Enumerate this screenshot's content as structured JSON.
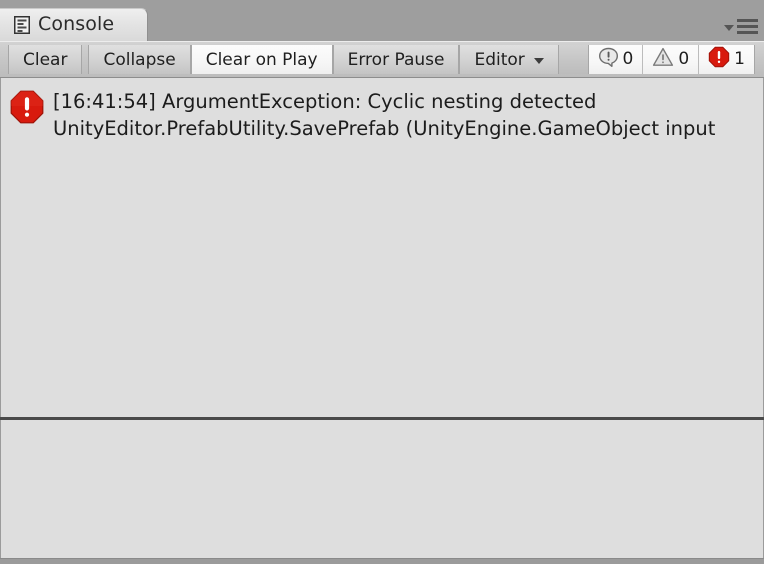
{
  "window": {
    "tab": {
      "label": "Console",
      "icon": "console-document-icon"
    },
    "menu": {
      "icon": "hamburger-menu-icon",
      "caret_icon": "caret-down-icon"
    }
  },
  "toolbar": {
    "buttons": [
      {
        "label": "Clear",
        "name": "clear-button",
        "active": false
      },
      {
        "label": "Collapse",
        "name": "collapse-button",
        "active": false
      },
      {
        "label": "Clear on Play",
        "name": "clear-on-play-button",
        "active": true
      },
      {
        "label": "Error Pause",
        "name": "error-pause-button",
        "active": false
      },
      {
        "label": "Editor",
        "name": "editor-dropdown-button",
        "active": false
      }
    ],
    "counts": [
      {
        "type": "log",
        "icon": "log-bubble-icon",
        "value": "0"
      },
      {
        "type": "warning",
        "icon": "warning-triangle-icon",
        "value": "0"
      },
      {
        "type": "error",
        "icon": "error-octagon-icon",
        "value": "1"
      }
    ]
  },
  "console": {
    "messages": [
      {
        "severity": "error",
        "icon": "error-octagon-icon",
        "line1": "[16:41:54] ArgumentException: Cyclic nesting detected",
        "line2": "UnityEditor.PrefabUtility.SavePrefab (UnityEngine.GameObject input"
      }
    ],
    "detail_text": ""
  },
  "colors": {
    "error_red": "#d81a0e",
    "chrome_gray": "#9b9b9b",
    "panel_bg": "#dedede",
    "toolbar_bg": "#c6c6c6",
    "splitter": "#4a4a4a"
  }
}
